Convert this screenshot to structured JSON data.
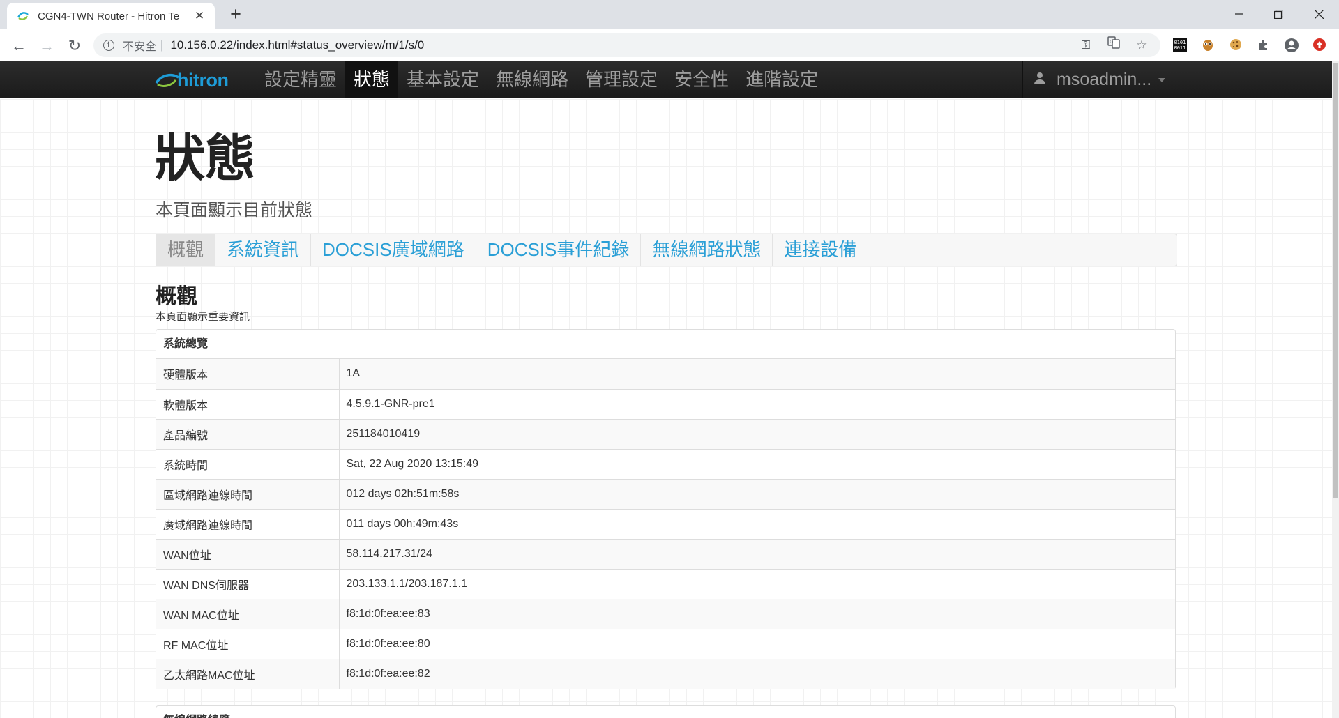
{
  "browser": {
    "tab_title": "CGN4-TWN Router - Hitron Te",
    "insecure_label": "不安全",
    "separator": "|",
    "url": "10.156.0.22/index.html#status_overview/m/1/s/0"
  },
  "navbar": {
    "brand": "hitron",
    "menu": [
      "設定精靈",
      "狀態",
      "基本設定",
      "無線網路",
      "管理設定",
      "安全性",
      "進階設定"
    ],
    "active_menu": "狀態",
    "user": "msoadmin..."
  },
  "page": {
    "title": "狀態",
    "subtitle": "本頁面顯示目前狀態",
    "tabs": [
      "概觀",
      "系統資訊",
      "DOCSIS廣域網路",
      "DOCSIS事件紀錄",
      "無線網路狀態",
      "連接設備"
    ],
    "active_tab": "概觀",
    "section_title": "概觀",
    "section_subtitle": "本頁面顯示重要資訊"
  },
  "system_panel": {
    "heading": "系統總覽",
    "rows": [
      {
        "label": "硬體版本",
        "value": "1A"
      },
      {
        "label": "軟體版本",
        "value": "4.5.9.1-GNR-pre1"
      },
      {
        "label": "產品編號",
        "value": "251184010419"
      },
      {
        "label": "系統時間",
        "value": "Sat, 22 Aug 2020 13:15:49"
      },
      {
        "label": "區域網路連線時間",
        "value": "012 days 02h:51m:58s"
      },
      {
        "label": "廣域網路連線時間",
        "value": "011 days 00h:49m:43s"
      },
      {
        "label": "WAN位址",
        "value": "58.114.217.31/24"
      },
      {
        "label": "WAN DNS伺服器",
        "value": "203.133.1.1/203.187.1.1"
      },
      {
        "label": "WAN MAC位址",
        "value": "f8:1d:0f:ea:ee:83"
      },
      {
        "label": "RF MAC位址",
        "value": "f8:1d:0f:ea:ee:80"
      },
      {
        "label": "乙太網路MAC位址",
        "value": "f8:1d:0f:ea:ee:82"
      }
    ]
  },
  "second_panel": {
    "heading": "無線網路總覽"
  },
  "colors": {
    "brand": "#1e9cd7",
    "link": "#2a9fd6",
    "navbar": "#222222"
  }
}
